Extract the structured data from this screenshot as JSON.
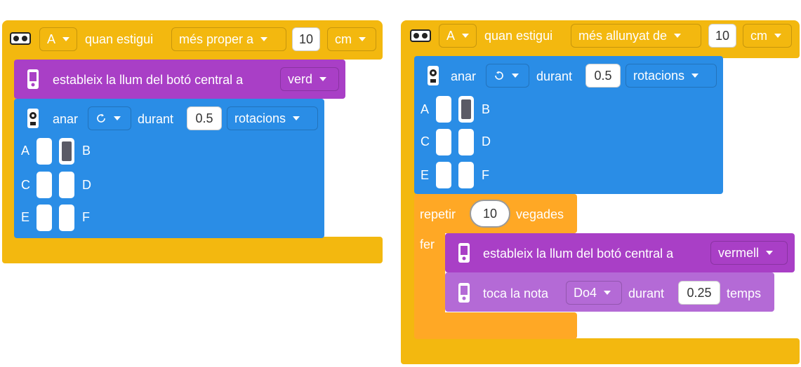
{
  "left_script": {
    "hat": {
      "sensor_port": "A",
      "when_label": "quan estigui",
      "comparison": "més proper a",
      "distance": "10",
      "unit": "cm"
    },
    "light_block": {
      "label": "estableix la llum del botó central a",
      "color": "verd"
    },
    "move_block": {
      "label": "anar",
      "direction_icon": "clockwise-icon",
      "during_label": "durant",
      "amount": "0.5",
      "unit": "rotacions",
      "ports": {
        "a": "A",
        "b": "B",
        "c": "C",
        "d": "D",
        "e": "E",
        "f": "F"
      }
    }
  },
  "right_script": {
    "hat": {
      "sensor_port": "A",
      "when_label": "quan estigui",
      "comparison": "més allunyat de",
      "distance": "10",
      "unit": "cm"
    },
    "move_block": {
      "label": "anar",
      "direction_icon": "counterclockwise-icon",
      "during_label": "durant",
      "amount": "0.5",
      "unit": "rotacions",
      "ports": {
        "a": "A",
        "b": "B",
        "c": "C",
        "d": "D",
        "e": "E",
        "f": "F"
      }
    },
    "repeat_block": {
      "repeat_label": "repetir",
      "times": "10",
      "times_label": "vegades",
      "do_label": "fer"
    },
    "light_block": {
      "label": "estableix la llum del botó central a",
      "color": "vermell"
    },
    "note_block": {
      "label": "toca la nota",
      "note": "Do4",
      "during_label": "durant",
      "duration": "0.25",
      "unit_label": "temps"
    }
  },
  "colors": {
    "events": "#f3b80f",
    "motors": "#2a8de6",
    "light": "#a93fc6",
    "sound": "#b46ad6",
    "control": "#ffa825"
  }
}
